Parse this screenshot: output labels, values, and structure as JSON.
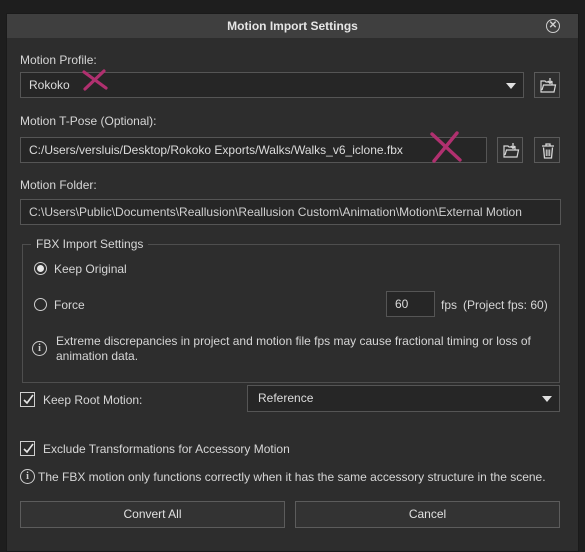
{
  "dialog": {
    "title": "Motion Import Settings",
    "close_icon": "close-icon"
  },
  "motion_profile": {
    "label": "Motion Profile:",
    "value": "Rokoko"
  },
  "motion_tpose": {
    "label": "Motion T-Pose (Optional):",
    "value": "C:/Users/versluis/Desktop/Rokoko Exports/Walks/Walks_v6_iclone.fbx"
  },
  "motion_folder": {
    "label": "Motion Folder:",
    "value": "C:\\Users\\Public\\Documents\\Reallusion\\Reallusion Custom\\Animation\\Motion\\External Motion"
  },
  "fbx_import": {
    "title": "FBX Import Settings",
    "keep_original_label": "Keep Original",
    "keep_original_selected": true,
    "force_label": "Force",
    "force_selected": false,
    "fps_value": "60",
    "fps_label": "fps",
    "project_fps_text": "(Project fps: 60)",
    "warning_text_line1": "Extreme discrepancies in project and motion file fps may cause fractional timing or loss of",
    "warning_text_line2": "animation data."
  },
  "keep_root_motion": {
    "label": "Keep Root Motion:",
    "checked": true,
    "value": "Reference"
  },
  "exclude_transformations": {
    "label": "Exclude Transformations for Accessory Motion",
    "checked": true
  },
  "accessory_note": "The FBX motion only functions correctly when it has the same accessory structure in the scene.",
  "buttons": {
    "convert_all": "Convert All",
    "cancel": "Cancel"
  },
  "colors": {
    "background": "#2d2d2d",
    "titlebar": "#3f3f3f",
    "annotation_mark": "#b0306f"
  }
}
